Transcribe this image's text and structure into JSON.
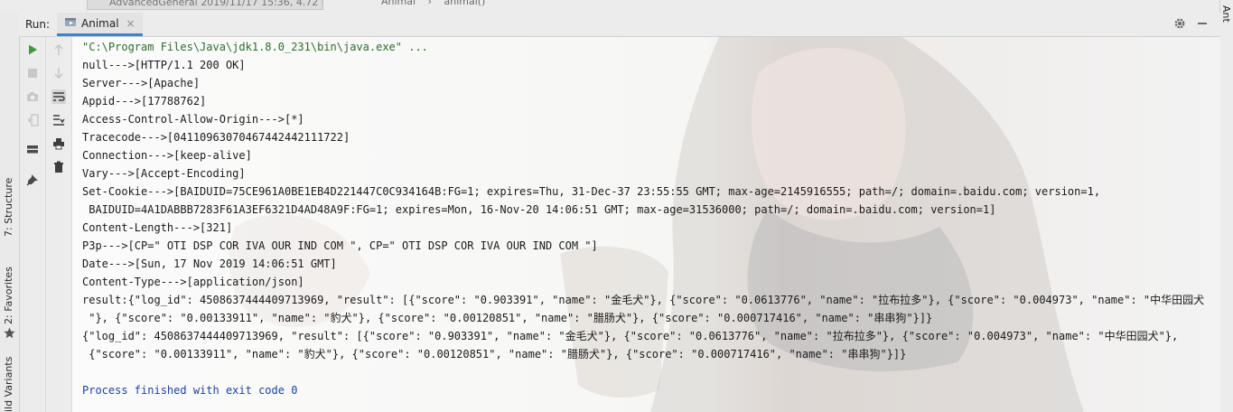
{
  "top_bar": {
    "file_tab_text": "AdvancedGeneral",
    "file_tab_meta": "2019/11/17 15:36, 4.72 KB",
    "breadcrumb_class": "Animal",
    "breadcrumb_sep": "›",
    "breadcrumb_method": "animal()"
  },
  "left_stripe": {
    "tabs": [
      "7: Structure",
      "2: Favorites",
      "ild Variants"
    ]
  },
  "right_stripe": {
    "label": "Ant"
  },
  "run_panel": {
    "label": "Run:",
    "tab_label": "Animal",
    "close_glyph": "×"
  },
  "console": {
    "lines": [
      "\"C:\\Program Files\\Java\\jdk1.8.0_231\\bin\\java.exe\" ...",
      "null--->[HTTP/1.1 200 OK]",
      "Server--->[Apache]",
      "Appid--->[17788762]",
      "Access-Control-Allow-Origin--->[*]",
      "Tracecode--->[04110963070467442442111722]",
      "Connection--->[keep-alive]",
      "Vary--->[Accept-Encoding]",
      "Set-Cookie--->[BAIDUID=75CE961A0BE1EB4D221447C0C934164B:FG=1; expires=Thu, 31-Dec-37 23:55:55 GMT; max-age=2145916555; path=/; domain=.baidu.com; version=1,",
      " BAIDUID=4A1DABBB7283F61A3EF6321D4AD48A9F:FG=1; expires=Mon, 16-Nov-20 14:06:51 GMT; max-age=31536000; path=/; domain=.baidu.com; version=1]",
      "Content-Length--->[321]",
      "P3p--->[CP=\" OTI DSP COR IVA OUR IND COM \", CP=\" OTI DSP COR IVA OUR IND COM \"]",
      "Date--->[Sun, 17 Nov 2019 14:06:51 GMT]",
      "Content-Type--->[application/json]",
      "result:{\"log_id\": 4508637444409713969, \"result\": [{\"score\": \"0.903391\", \"name\": \"金毛犬\"}, {\"score\": \"0.0613776\", \"name\": \"拉布拉多\"}, {\"score\": \"0.004973\", \"name\": \"中华田园犬",
      " \"}, {\"score\": \"0.00133911\", \"name\": \"豹犬\"}, {\"score\": \"0.00120851\", \"name\": \"腊肠犬\"}, {\"score\": \"0.000717416\", \"name\": \"串串狗\"}]}",
      "{\"log_id\": 4508637444409713969, \"result\": [{\"score\": \"0.903391\", \"name\": \"金毛犬\"}, {\"score\": \"0.0613776\", \"name\": \"拉布拉多\"}, {\"score\": \"0.004973\", \"name\": \"中华田园犬\"},",
      " {\"score\": \"0.00133911\", \"name\": \"豹犬\"}, {\"score\": \"0.00120851\", \"name\": \"腊肠犬\"}, {\"score\": \"0.000717416\", \"name\": \"串串狗\"}]}",
      "",
      "Process finished with exit code 0"
    ]
  }
}
